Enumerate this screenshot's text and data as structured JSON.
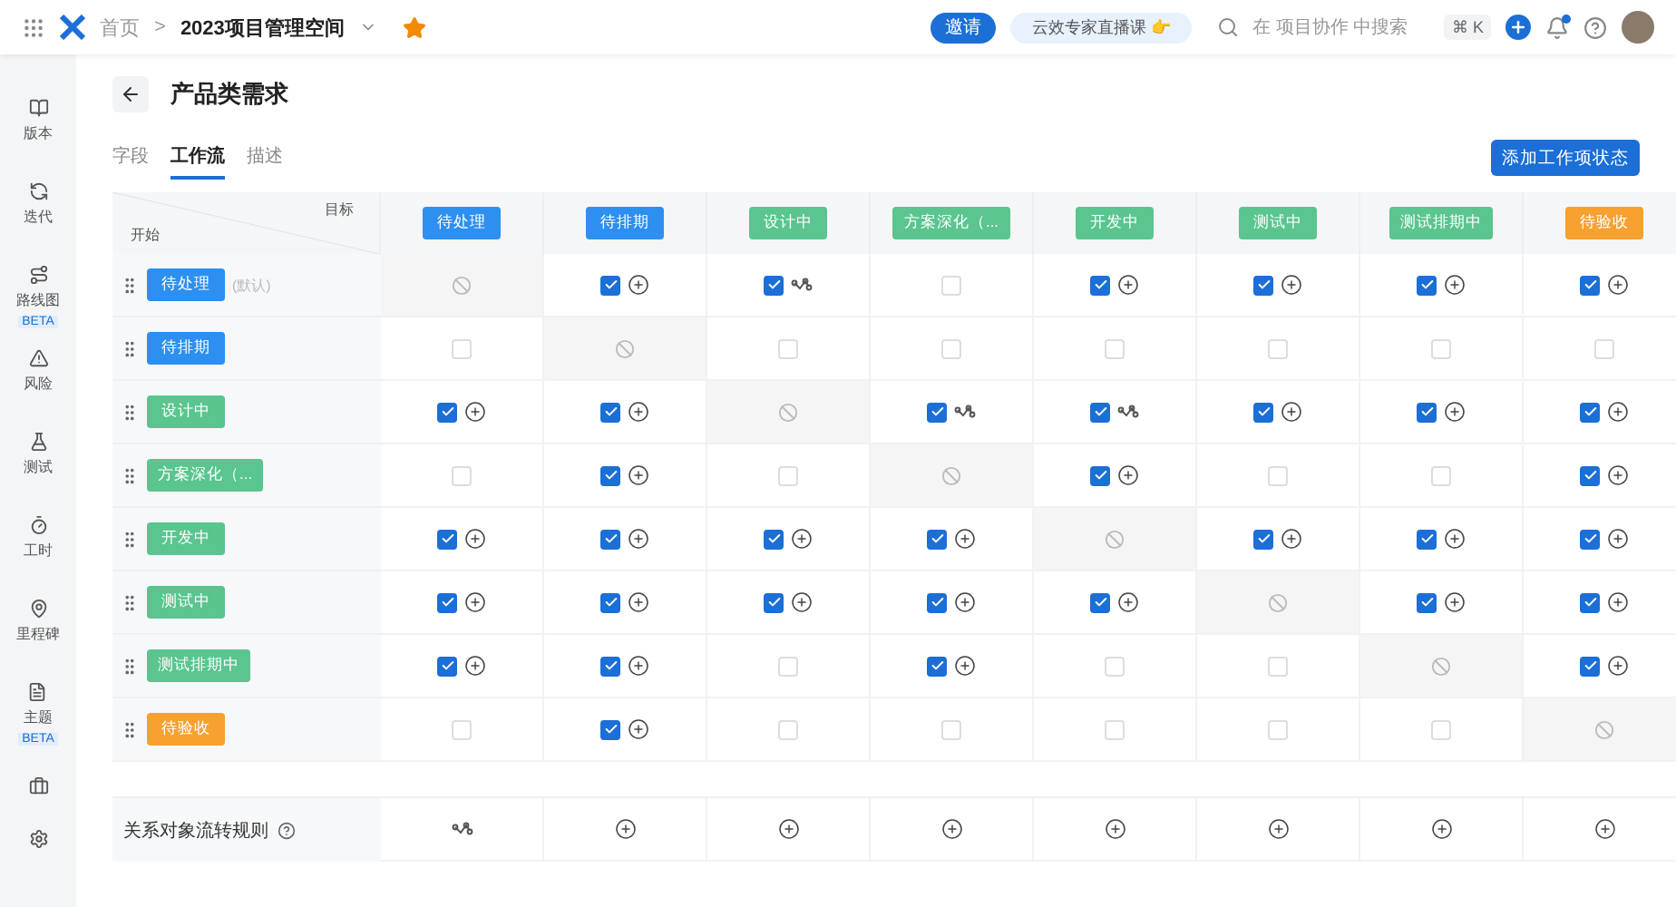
{
  "header": {
    "breadcrumb_home": "首页",
    "breadcrumb_separator": ">",
    "project": "2023项目管理空间",
    "starred": true,
    "invite": "邀请",
    "promo": "云效专家直播课 👉",
    "search": {
      "placeholder": "在 项目协作 中搜索"
    },
    "shortcut": "⌘ K",
    "notification_dot": true
  },
  "sidebar": {
    "items": [
      {
        "label": "版本"
      },
      {
        "label": "迭代"
      },
      {
        "label": "路线图",
        "badge": "BETA"
      },
      {
        "label": "风险"
      },
      {
        "label": "测试"
      },
      {
        "label": "工时"
      },
      {
        "label": "里程碑"
      },
      {
        "label": "主题",
        "badge": "BETA"
      }
    ]
  },
  "page": {
    "title": "产品类需求",
    "tabs": [
      {
        "label": "字段",
        "selected": false
      },
      {
        "label": "工作流",
        "selected": true
      },
      {
        "label": "描述",
        "selected": false
      }
    ],
    "add_button": "添加工作项状态"
  },
  "table": {
    "corner_target": "目标",
    "corner_start": "开始",
    "columns": [
      {
        "name": "待处理",
        "color": "#2d8ff0"
      },
      {
        "name": "待排期",
        "color": "#2d8ff0"
      },
      {
        "name": "设计中",
        "color": "#5ac58f"
      },
      {
        "name": "方案深化（...",
        "color": "#5ac58f"
      },
      {
        "name": "开发中",
        "color": "#5ac58f"
      },
      {
        "name": "测试中",
        "color": "#5ac58f"
      },
      {
        "name": "测试排期中",
        "color": "#5ac58f"
      },
      {
        "name": "待验收",
        "color": "#f7a130"
      }
    ],
    "rows": [
      {
        "name": "待处理",
        "color": "#2d8ff0",
        "note": "(默认)",
        "cells": [
          {
            "kind": "self"
          },
          {
            "kind": "add",
            "checked": true
          },
          {
            "kind": "flow",
            "checked": true
          },
          {
            "kind": "plain",
            "checked": false
          },
          {
            "kind": "add",
            "checked": true
          },
          {
            "kind": "add",
            "checked": true
          },
          {
            "kind": "add",
            "checked": true
          },
          {
            "kind": "add",
            "checked": true
          }
        ]
      },
      {
        "name": "待排期",
        "color": "#2d8ff0",
        "cells": [
          {
            "kind": "plain",
            "checked": false
          },
          {
            "kind": "self"
          },
          {
            "kind": "plain",
            "checked": false
          },
          {
            "kind": "plain",
            "checked": false
          },
          {
            "kind": "plain",
            "checked": false
          },
          {
            "kind": "plain",
            "checked": false
          },
          {
            "kind": "plain",
            "checked": false
          },
          {
            "kind": "plain",
            "checked": false
          }
        ]
      },
      {
        "name": "设计中",
        "color": "#5ac58f",
        "cells": [
          {
            "kind": "add",
            "checked": true
          },
          {
            "kind": "add",
            "checked": true
          },
          {
            "kind": "self"
          },
          {
            "kind": "flow",
            "checked": true
          },
          {
            "kind": "flow",
            "checked": true
          },
          {
            "kind": "add",
            "checked": true
          },
          {
            "kind": "add",
            "checked": true
          },
          {
            "kind": "add",
            "checked": true
          }
        ]
      },
      {
        "name": "方案深化（...",
        "color": "#5ac58f",
        "cells": [
          {
            "kind": "plain",
            "checked": false
          },
          {
            "kind": "add",
            "checked": true
          },
          {
            "kind": "plain",
            "checked": false
          },
          {
            "kind": "self"
          },
          {
            "kind": "add",
            "checked": true
          },
          {
            "kind": "plain",
            "checked": false
          },
          {
            "kind": "plain",
            "checked": false
          },
          {
            "kind": "add",
            "checked": true
          }
        ]
      },
      {
        "name": "开发中",
        "color": "#5ac58f",
        "cells": [
          {
            "kind": "add",
            "checked": true
          },
          {
            "kind": "add",
            "checked": true
          },
          {
            "kind": "add",
            "checked": true
          },
          {
            "kind": "add",
            "checked": true
          },
          {
            "kind": "self"
          },
          {
            "kind": "add",
            "checked": true
          },
          {
            "kind": "add",
            "checked": true
          },
          {
            "kind": "add",
            "checked": true
          }
        ]
      },
      {
        "name": "测试中",
        "color": "#5ac58f",
        "cells": [
          {
            "kind": "add",
            "checked": true
          },
          {
            "kind": "add",
            "checked": true
          },
          {
            "kind": "add",
            "checked": true
          },
          {
            "kind": "add",
            "checked": true
          },
          {
            "kind": "add",
            "checked": true
          },
          {
            "kind": "self"
          },
          {
            "kind": "add",
            "checked": true
          },
          {
            "kind": "add",
            "checked": true
          }
        ]
      },
      {
        "name": "测试排期中",
        "color": "#5ac58f",
        "cells": [
          {
            "kind": "add",
            "checked": true
          },
          {
            "kind": "add",
            "checked": true
          },
          {
            "kind": "plain",
            "checked": false
          },
          {
            "kind": "add",
            "checked": true
          },
          {
            "kind": "plain",
            "checked": false
          },
          {
            "kind": "plain",
            "checked": false
          },
          {
            "kind": "self"
          },
          {
            "kind": "add",
            "checked": true
          }
        ]
      },
      {
        "name": "待验收",
        "color": "#f7a130",
        "cells": [
          {
            "kind": "plain",
            "checked": false
          },
          {
            "kind": "add",
            "checked": true
          },
          {
            "kind": "plain",
            "checked": false
          },
          {
            "kind": "plain",
            "checked": false
          },
          {
            "kind": "plain",
            "checked": false
          },
          {
            "kind": "plain",
            "checked": false
          },
          {
            "kind": "plain",
            "checked": false
          },
          {
            "kind": "self"
          }
        ]
      }
    ],
    "footer": {
      "label": "关系对象流转规则",
      "cells": [
        {
          "kind": "flow"
        },
        {
          "kind": "add"
        },
        {
          "kind": "add"
        },
        {
          "kind": "add"
        },
        {
          "kind": "add"
        },
        {
          "kind": "add"
        },
        {
          "kind": "add"
        },
        {
          "kind": "add"
        }
      ]
    }
  }
}
